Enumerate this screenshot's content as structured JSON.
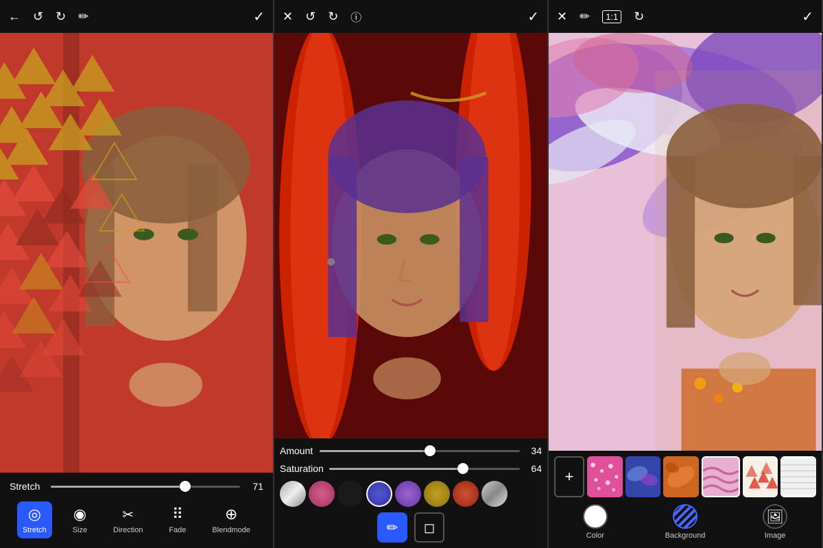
{
  "panels": [
    {
      "id": "panel1",
      "toolbar": {
        "back": "←",
        "undo": "↺",
        "redo": "↻",
        "eraser": "✏",
        "check": "✓"
      },
      "slider": {
        "label": "Stretch",
        "value": 71,
        "fill_percent": 71
      },
      "tools": [
        {
          "id": "stretch",
          "label": "Stretch",
          "icon": "◎",
          "active": true
        },
        {
          "id": "size",
          "label": "Size",
          "icon": "◉",
          "active": false
        },
        {
          "id": "direction",
          "label": "Direction",
          "icon": "✂",
          "active": false
        },
        {
          "id": "fade",
          "label": "Fade",
          "icon": "⠿",
          "active": false
        },
        {
          "id": "blendmode",
          "label": "Blendmode",
          "icon": "⊕",
          "active": false
        }
      ]
    },
    {
      "id": "panel2",
      "toolbar": {
        "close": "✕",
        "undo": "↺",
        "redo": "↻",
        "info": "ⓘ",
        "check": "✓"
      },
      "amount": {
        "label": "Amount",
        "value": 34,
        "fill_percent": 55
      },
      "saturation": {
        "label": "Saturation",
        "value": 64,
        "fill_percent": 70
      },
      "swatches": [
        {
          "color": "#c8c8c8",
          "selected": false
        },
        {
          "color": "#d4608a",
          "selected": false
        },
        {
          "color": "#222222",
          "selected": false
        },
        {
          "color": "#4a3acc",
          "selected": true
        },
        {
          "color": "#7a4ab8",
          "selected": false
        },
        {
          "color": "#baa430",
          "selected": false
        },
        {
          "color": "#cc4422",
          "selected": false
        },
        {
          "color": "#bbbbbb",
          "selected": false
        }
      ],
      "brush_tools": [
        {
          "id": "brush",
          "icon": "✏",
          "active": true
        },
        {
          "id": "eraser",
          "icon": "◻",
          "active": false
        }
      ]
    },
    {
      "id": "panel3",
      "toolbar": {
        "close": "✕",
        "eraser": "✏",
        "ratio": "1:1",
        "rotate": "↻",
        "check": "✓"
      },
      "bg_thumbs": [
        {
          "color": "#e0609a",
          "pattern": "dots"
        },
        {
          "color": "#4455aa",
          "pattern": "splat"
        },
        {
          "color": "#cc6622",
          "pattern": "brush"
        },
        {
          "color": "#e8a0c0",
          "pattern": "wave"
        },
        {
          "color": "#dd3322",
          "pattern": "triangles"
        },
        {
          "color": "#f0f0f0",
          "pattern": "lines"
        }
      ],
      "types": [
        {
          "id": "color",
          "label": "Color",
          "icon_type": "circle-white"
        },
        {
          "id": "background",
          "label": "Background",
          "icon_type": "stripe"
        },
        {
          "id": "image",
          "label": "Image",
          "icon_type": "image"
        }
      ]
    }
  ]
}
